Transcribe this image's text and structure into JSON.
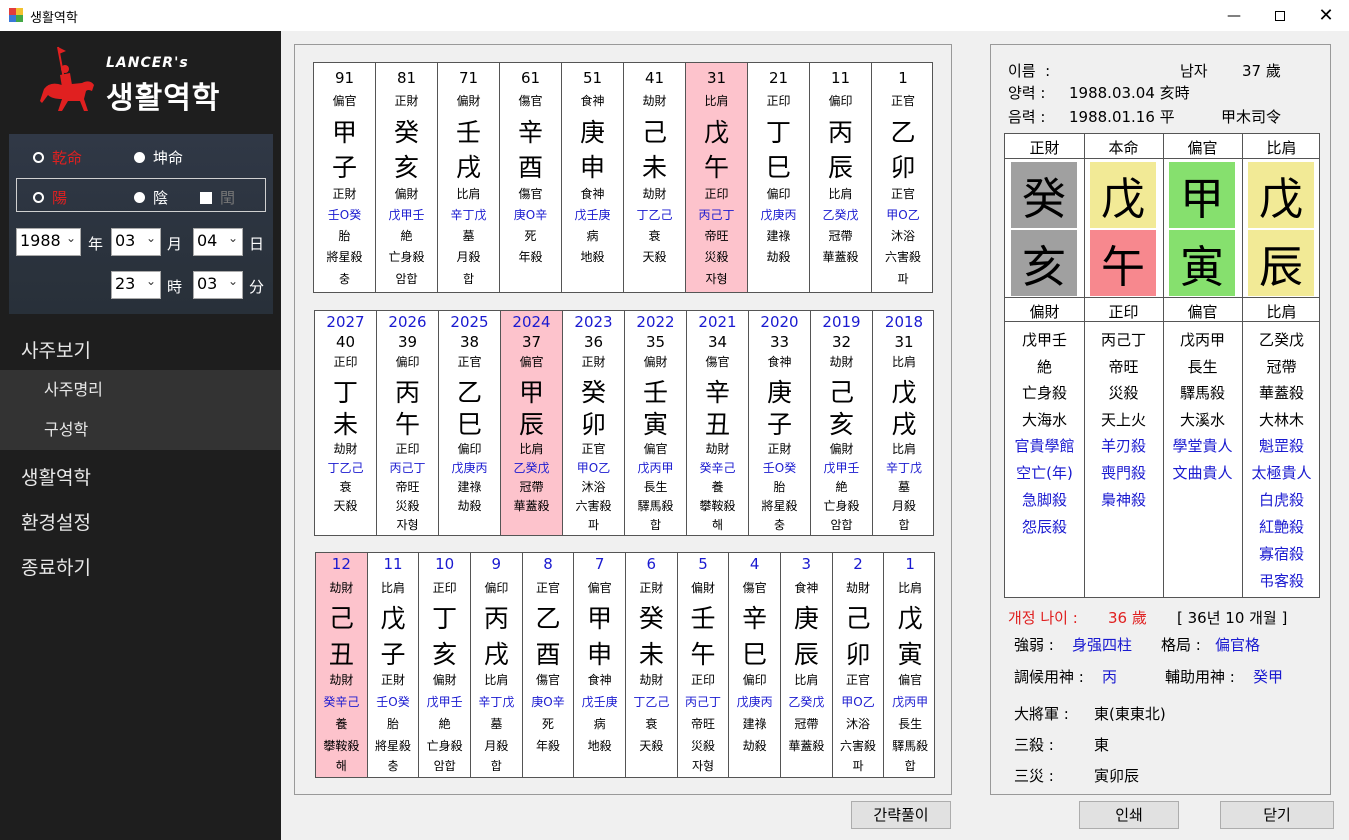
{
  "window": {
    "title": "생활역학",
    "icon": "app-icon"
  },
  "logo": {
    "brand": "LANCER's",
    "name": "생활역학"
  },
  "options": {
    "qian": "乾命",
    "kun": "坤命",
    "yang": "陽",
    "yin": "陰",
    "leap": "閏"
  },
  "birth": {
    "year": "1988",
    "year_label": "年",
    "month": "03",
    "month_label": "月",
    "day": "04",
    "day_label": "日",
    "hour": "23",
    "hour_label": "時",
    "minute": "03",
    "minute_label": "分"
  },
  "menu": {
    "saju": "사주보기",
    "saju_myeongri": "사주명리",
    "gusung": "구성학",
    "life": "생활역학",
    "settings": "환경설정",
    "exit": "종료하기"
  },
  "daewoon": [
    {
      "age": "91",
      "ss": "偏官",
      "g": "甲",
      "j": "子",
      "ss2": "正財",
      "hid": "壬O癸",
      "st": "胎",
      "sal": "將星殺",
      "rel": "충",
      "hi": false
    },
    {
      "age": "81",
      "ss": "正財",
      "g": "癸",
      "j": "亥",
      "ss2": "偏財",
      "hid": "戊甲壬",
      "st": "絶",
      "sal": "亡身殺",
      "rel": "암합",
      "hi": false
    },
    {
      "age": "71",
      "ss": "偏財",
      "g": "壬",
      "j": "戌",
      "ss2": "比肩",
      "hid": "辛丁戊",
      "st": "墓",
      "sal": "月殺",
      "rel": "합",
      "hi": false
    },
    {
      "age": "61",
      "ss": "傷官",
      "g": "辛",
      "j": "酉",
      "ss2": "傷官",
      "hid": "庚O辛",
      "st": "死",
      "sal": "年殺",
      "rel": "",
      "hi": false
    },
    {
      "age": "51",
      "ss": "食神",
      "g": "庚",
      "j": "申",
      "ss2": "食神",
      "hid": "戊壬庚",
      "st": "病",
      "sal": "地殺",
      "rel": "",
      "hi": false
    },
    {
      "age": "41",
      "ss": "劫財",
      "g": "己",
      "j": "未",
      "ss2": "劫財",
      "hid": "丁乙己",
      "st": "衰",
      "sal": "天殺",
      "rel": "",
      "hi": false
    },
    {
      "age": "31",
      "ss": "比肩",
      "g": "戊",
      "j": "午",
      "ss2": "正印",
      "hid": "丙己丁",
      "st": "帝旺",
      "sal": "災殺",
      "rel": "자형",
      "hi": true
    },
    {
      "age": "21",
      "ss": "正印",
      "g": "丁",
      "j": "巳",
      "ss2": "偏印",
      "hid": "戊庚丙",
      "st": "建祿",
      "sal": "劫殺",
      "rel": "",
      "hi": false
    },
    {
      "age": "11",
      "ss": "偏印",
      "g": "丙",
      "j": "辰",
      "ss2": "比肩",
      "hid": "乙癸戊",
      "st": "冠帶",
      "sal": "華蓋殺",
      "rel": "",
      "hi": false
    },
    {
      "age": "1",
      "ss": "正官",
      "g": "乙",
      "j": "卯",
      "ss2": "正官",
      "hid": "甲O乙",
      "st": "沐浴",
      "sal": "六害殺",
      "rel": "파",
      "hi": false
    }
  ],
  "yearly": [
    {
      "yr": "2027",
      "age": "40",
      "ss": "正印",
      "g": "丁",
      "j": "未",
      "ss2": "劫財",
      "hid": "丁乙己",
      "st": "衰",
      "sal": "天殺",
      "rel": "",
      "hi": false
    },
    {
      "yr": "2026",
      "age": "39",
      "ss": "偏印",
      "g": "丙",
      "j": "午",
      "ss2": "正印",
      "hid": "丙己丁",
      "st": "帝旺",
      "sal": "災殺",
      "rel": "자형",
      "hi": false
    },
    {
      "yr": "2025",
      "age": "38",
      "ss": "正官",
      "g": "乙",
      "j": "巳",
      "ss2": "偏印",
      "hid": "戊庚丙",
      "st": "建祿",
      "sal": "劫殺",
      "rel": "",
      "hi": false
    },
    {
      "yr": "2024",
      "age": "37",
      "ss": "偏官",
      "g": "甲",
      "j": "辰",
      "ss2": "比肩",
      "hid": "乙癸戊",
      "st": "冠帶",
      "sal": "華蓋殺",
      "rel": "",
      "hi": true
    },
    {
      "yr": "2023",
      "age": "36",
      "ss": "正財",
      "g": "癸",
      "j": "卯",
      "ss2": "正官",
      "hid": "甲O乙",
      "st": "沐浴",
      "sal": "六害殺",
      "rel": "파",
      "hi": false
    },
    {
      "yr": "2022",
      "age": "35",
      "ss": "偏財",
      "g": "壬",
      "j": "寅",
      "ss2": "偏官",
      "hid": "戊丙甲",
      "st": "長生",
      "sal": "驛馬殺",
      "rel": "합",
      "hi": false
    },
    {
      "yr": "2021",
      "age": "34",
      "ss": "傷官",
      "g": "辛",
      "j": "丑",
      "ss2": "劫財",
      "hid": "癸辛己",
      "st": "養",
      "sal": "攀鞍殺",
      "rel": "해",
      "hi": false
    },
    {
      "yr": "2020",
      "age": "33",
      "ss": "食神",
      "g": "庚",
      "j": "子",
      "ss2": "正財",
      "hid": "壬O癸",
      "st": "胎",
      "sal": "將星殺",
      "rel": "충",
      "hi": false
    },
    {
      "yr": "2019",
      "age": "32",
      "ss": "劫財",
      "g": "己",
      "j": "亥",
      "ss2": "偏財",
      "hid": "戊甲壬",
      "st": "絶",
      "sal": "亡身殺",
      "rel": "암합",
      "hi": false
    },
    {
      "yr": "2018",
      "age": "31",
      "ss": "比肩",
      "g": "戊",
      "j": "戌",
      "ss2": "比肩",
      "hid": "辛丁戊",
      "st": "墓",
      "sal": "月殺",
      "rel": "합",
      "hi": false
    }
  ],
  "monthly": [
    {
      "m": "12",
      "ss": "劫財",
      "g": "己",
      "j": "丑",
      "ss2": "劫財",
      "hid": "癸辛己",
      "st": "養",
      "sal": "攀鞍殺",
      "rel": "해",
      "hi": true
    },
    {
      "m": "11",
      "ss": "比肩",
      "g": "戊",
      "j": "子",
      "ss2": "正財",
      "hid": "壬O癸",
      "st": "胎",
      "sal": "將星殺",
      "rel": "충",
      "hi": false
    },
    {
      "m": "10",
      "ss": "正印",
      "g": "丁",
      "j": "亥",
      "ss2": "偏財",
      "hid": "戊甲壬",
      "st": "絶",
      "sal": "亡身殺",
      "rel": "암합",
      "hi": false
    },
    {
      "m": "9",
      "ss": "偏印",
      "g": "丙",
      "j": "戌",
      "ss2": "比肩",
      "hid": "辛丁戊",
      "st": "墓",
      "sal": "月殺",
      "rel": "합",
      "hi": false
    },
    {
      "m": "8",
      "ss": "正官",
      "g": "乙",
      "j": "酉",
      "ss2": "傷官",
      "hid": "庚O辛",
      "st": "死",
      "sal": "年殺",
      "rel": "",
      "hi": false
    },
    {
      "m": "7",
      "ss": "偏官",
      "g": "甲",
      "j": "申",
      "ss2": "食神",
      "hid": "戊壬庚",
      "st": "病",
      "sal": "地殺",
      "rel": "",
      "hi": false
    },
    {
      "m": "6",
      "ss": "正財",
      "g": "癸",
      "j": "未",
      "ss2": "劫財",
      "hid": "丁乙己",
      "st": "衰",
      "sal": "天殺",
      "rel": "",
      "hi": false
    },
    {
      "m": "5",
      "ss": "偏財",
      "g": "壬",
      "j": "午",
      "ss2": "正印",
      "hid": "丙己丁",
      "st": "帝旺",
      "sal": "災殺",
      "rel": "자형",
      "hi": false
    },
    {
      "m": "4",
      "ss": "傷官",
      "g": "辛",
      "j": "巳",
      "ss2": "偏印",
      "hid": "戊庚丙",
      "st": "建祿",
      "sal": "劫殺",
      "rel": "",
      "hi": false
    },
    {
      "m": "3",
      "ss": "食神",
      "g": "庚",
      "j": "辰",
      "ss2": "比肩",
      "hid": "乙癸戊",
      "st": "冠帶",
      "sal": "華蓋殺",
      "rel": "",
      "hi": false
    },
    {
      "m": "2",
      "ss": "劫財",
      "g": "己",
      "j": "卯",
      "ss2": "正官",
      "hid": "甲O乙",
      "st": "沐浴",
      "sal": "六害殺",
      "rel": "파",
      "hi": false
    },
    {
      "m": "1",
      "ss": "比肩",
      "g": "戊",
      "j": "寅",
      "ss2": "偏官",
      "hid": "戊丙甲",
      "st": "長生",
      "sal": "驛馬殺",
      "rel": "합",
      "hi": false
    }
  ],
  "person": {
    "name_label": "이름",
    "name_colon": ":",
    "gender": "남자",
    "age": "37 歲",
    "solar_label": "양력",
    "solar": "1988.03.04 亥時",
    "lunar_label": "음력",
    "lunar": "1988.01.16 平",
    "siryeong": "甲木司令"
  },
  "pillars": {
    "headers": [
      "正財",
      "本命",
      "偏官",
      "比肩"
    ],
    "stems": [
      {
        "c": "癸",
        "bg": "#a0a0a0"
      },
      {
        "c": "戊",
        "bg": "#f2ea96"
      },
      {
        "c": "甲",
        "bg": "#86e06e"
      },
      {
        "c": "戊",
        "bg": "#f2ea96"
      }
    ],
    "branches": [
      {
        "c": "亥",
        "bg": "#a0a0a0"
      },
      {
        "c": "午",
        "bg": "#f7888e"
      },
      {
        "c": "寅",
        "bg": "#86e06e"
      },
      {
        "c": "辰",
        "bg": "#f2ea96"
      }
    ],
    "subheaders": [
      "偏財",
      "正印",
      "偏官",
      "比肩"
    ],
    "cols": [
      [
        "戊甲壬",
        "絶",
        "亡身殺",
        "大海水"
      ],
      [
        "丙己丁",
        "帝旺",
        "災殺",
        "天上火"
      ],
      [
        "戊丙甲",
        "長生",
        "驛馬殺",
        "大溪水"
      ],
      [
        "乙癸戊",
        "冠帶",
        "華蓋殺",
        "大林木"
      ]
    ],
    "blue": [
      [
        "官貴學館",
        "空亡(年)",
        "急脚殺",
        "怨辰殺"
      ],
      [
        "羊刃殺",
        "喪門殺",
        "梟神殺"
      ],
      [
        "學堂貴人",
        "文曲貴人"
      ],
      [
        "魁罡殺",
        "太極貴人",
        "白虎殺",
        "紅艶殺",
        "寡宿殺",
        "弔客殺"
      ]
    ]
  },
  "analysis": {
    "revised_label": "개정 나이 :",
    "revised_age": "36 歲",
    "months": "[ 36년 10 개월 ]",
    "strength_label": "強弱 :",
    "strength": "身强四柱",
    "format_label": "格局 :",
    "format": "偏官格",
    "johu_label": "調候用神 :",
    "johu": "丙",
    "aux_label": "輔助用神 :",
    "aux": "癸甲",
    "general_label": "大將軍 :",
    "general": "東(東東北)",
    "samsal_label": "三殺 :",
    "samsal": "東",
    "samjae_label": "三災 :",
    "samjae": "寅卯辰"
  },
  "buttons": {
    "brief": "간략풀이",
    "print": "인쇄",
    "close": "닫기"
  }
}
